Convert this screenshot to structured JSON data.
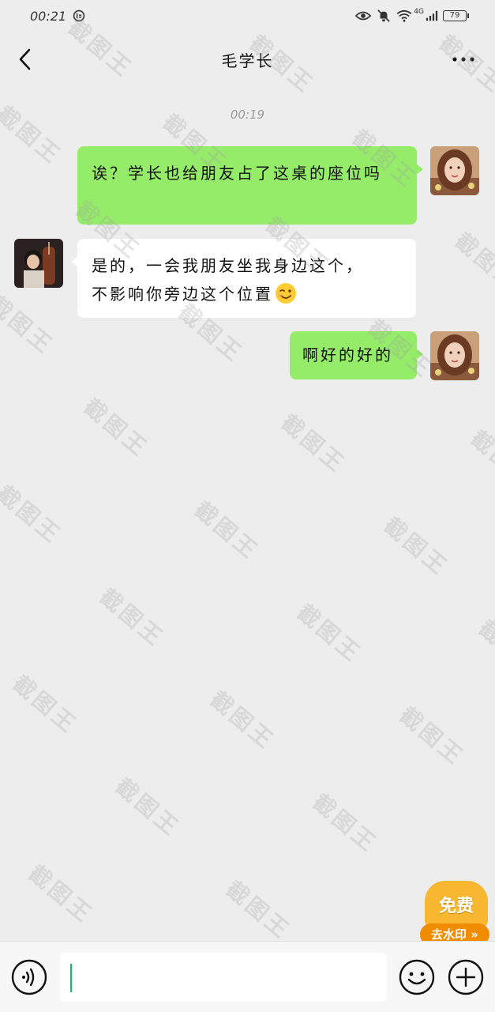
{
  "status_bar": {
    "time": "00:21",
    "network": "4G",
    "battery": "79"
  },
  "header": {
    "title": "毛学长"
  },
  "chat": {
    "timestamp": "00:19",
    "messages": [
      {
        "direction": "out",
        "text": "诶？学长也给朋友占了这桌的座位吗"
      },
      {
        "direction": "in",
        "line1": "是的，一会我朋友坐我身边这个，",
        "line2": "不影响你旁边这个位置",
        "emoji": "wink-face"
      },
      {
        "direction": "out",
        "text": "啊好的好的"
      }
    ]
  },
  "watermark": {
    "text": "截图王"
  },
  "promo": {
    "top": "免费",
    "bottom": "去水印 »"
  },
  "input_bar": {
    "value": ""
  },
  "colors": {
    "outgoing_bubble": "#95ec69",
    "incoming_bubble": "#ffffff",
    "background": "#ededed",
    "caret": "#07c160"
  }
}
